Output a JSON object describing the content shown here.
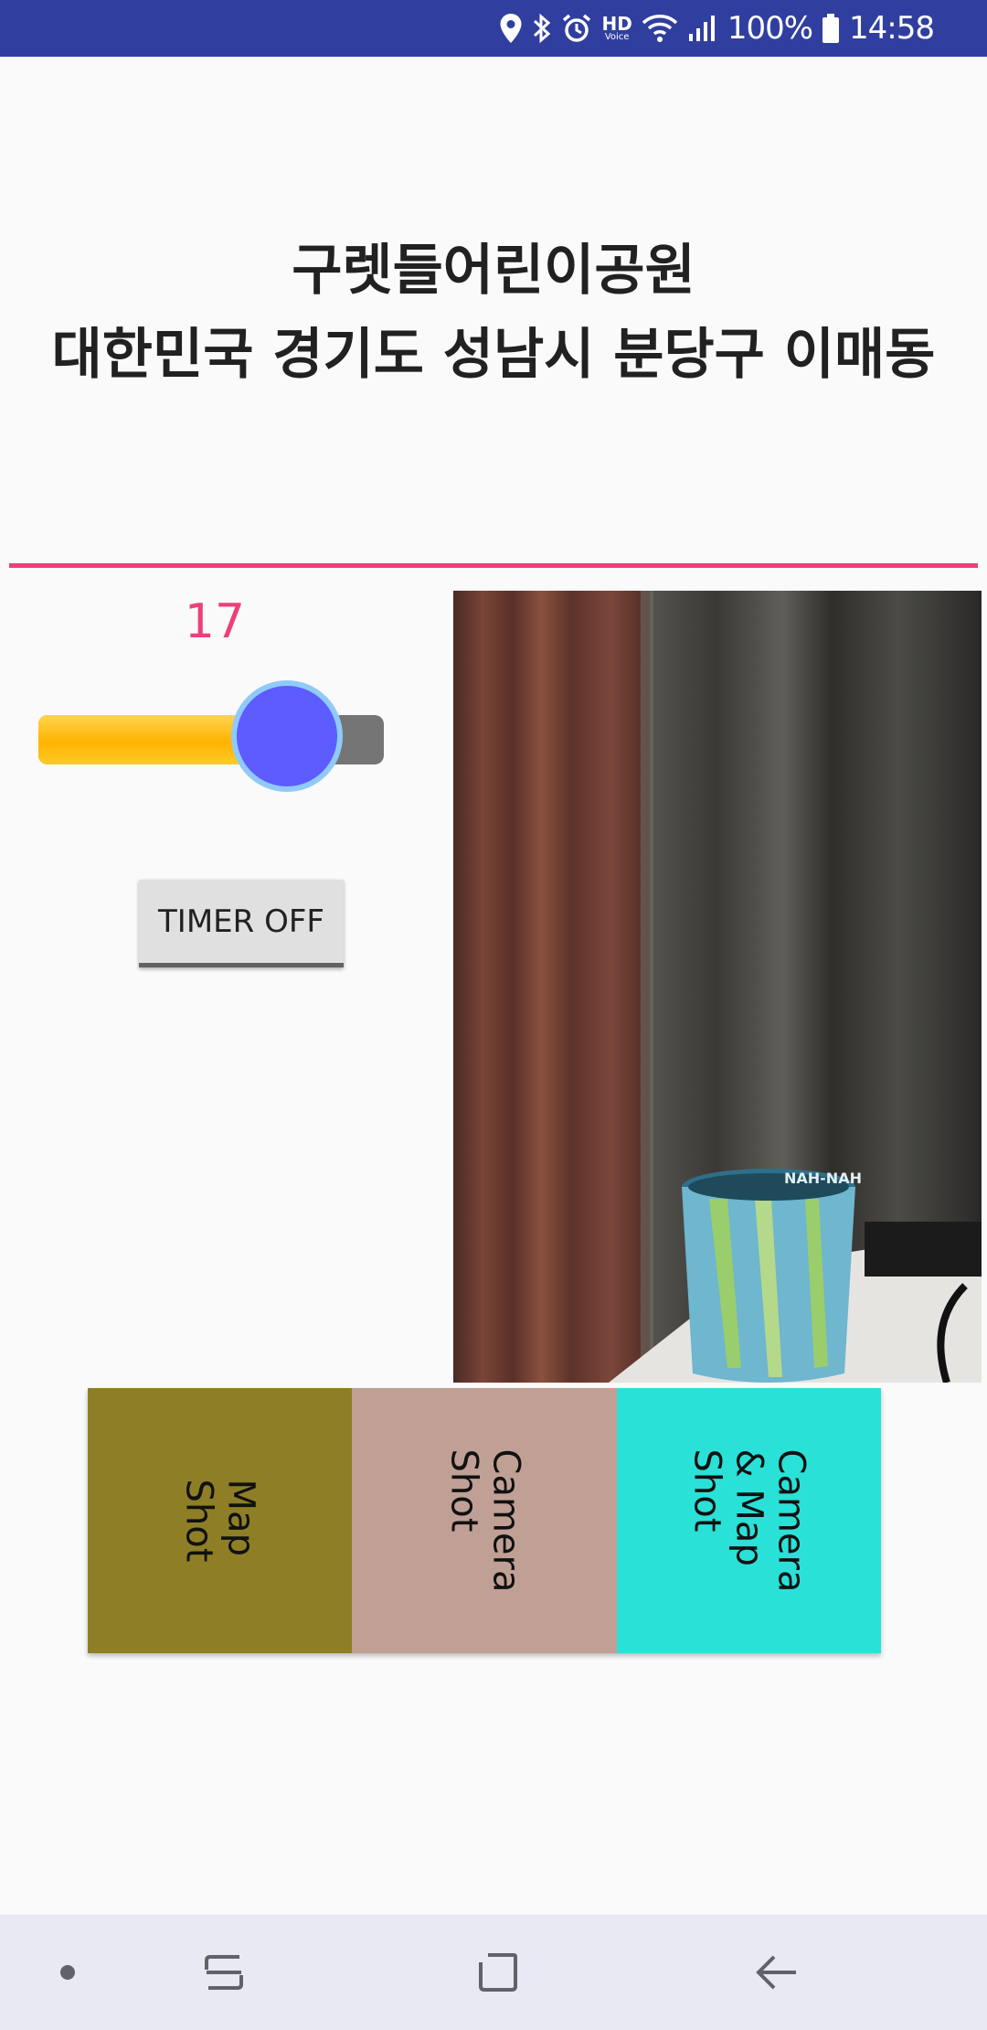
{
  "status_bar": {
    "battery": "100%",
    "time": "14:58",
    "hd_label": "HD",
    "voice_label": "Voice",
    "icons": [
      "location-icon",
      "bluetooth-icon",
      "alarm-icon",
      "hd-voice-icon",
      "wifi-icon",
      "signal-icon",
      "battery-icon"
    ]
  },
  "header": {
    "place_name": "구렛들어린이공원",
    "address": "대한민국 경기도 성남시 분당구 이매동"
  },
  "timer": {
    "value": "17",
    "slider_fraction": 0.72,
    "button_label": "TIMER OFF"
  },
  "camera_preview": {
    "mug_text": "NAH-NAH"
  },
  "shot_buttons": [
    {
      "label": "Map\nShot",
      "color": "#8e7f27"
    },
    {
      "label": "Camera\nShot",
      "color": "#c0a095"
    },
    {
      "label": "Camera\n& Map\nShot",
      "color": "#2ae1d8"
    }
  ],
  "colors": {
    "status_bar": "#303f9f",
    "accent": "#ec407a",
    "slider_fill": "#ffc107",
    "slider_thumb": "#5c5cff"
  },
  "nav_bar": {
    "icons": [
      "dot-icon",
      "recents-icon",
      "home-icon",
      "back-icon"
    ]
  }
}
